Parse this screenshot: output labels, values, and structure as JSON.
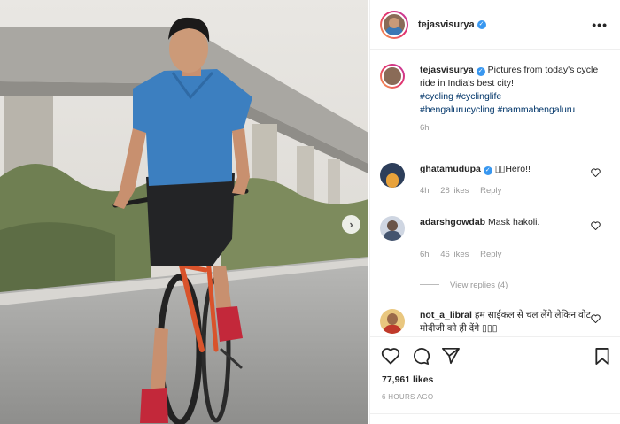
{
  "post": {
    "author": "tejasvisurya",
    "verified_mark": "✓",
    "more_icon": "•••",
    "next_icon": "›"
  },
  "caption": {
    "author": "tejasvisurya",
    "text": " Pictures from today's cycle ride in India's best city!",
    "hashtags": [
      "#cycling",
      "#cyclinglife",
      "#bengalurucycling",
      "#nammabengaluru"
    ],
    "age": "6h"
  },
  "comments": [
    {
      "user": "ghatamudupa",
      "verified": true,
      "text": " ▯▯Hero!!",
      "age": "4h",
      "likes": "28 likes",
      "reply": "Reply"
    },
    {
      "user": "adarshgowdab",
      "verified": false,
      "text": " Mask hakoli.",
      "age": "6h",
      "likes": "46 likes",
      "reply": "Reply"
    },
    {
      "user": "not_a_libral",
      "verified": false,
      "text": " हम साईकल से चल लेंगे लेकिन वोट मोदीजी को ही देंगे ▯▯▯"
    }
  ],
  "view_replies": "View replies (4)",
  "footer": {
    "likes": "77,961 likes",
    "time": "6 HOURS AGO"
  },
  "icons": [
    "heart-icon",
    "comment-icon",
    "share-icon",
    "bookmark-icon",
    "more-icon",
    "next-arrow-icon"
  ],
  "colors": {
    "verified": "#3897f0",
    "hashtag": "#003569",
    "muted": "#999999",
    "shirt": "#3c7fc0",
    "bike": "#d9532b"
  }
}
